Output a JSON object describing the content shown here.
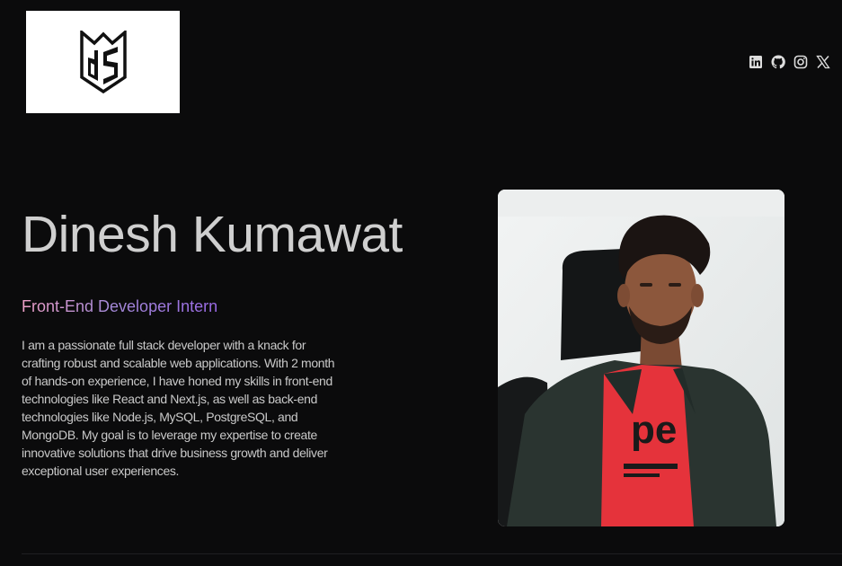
{
  "logo": {
    "icon": "ds-monogram-logo"
  },
  "social_links": [
    {
      "icon": "linkedin-icon"
    },
    {
      "icon": "github-icon"
    },
    {
      "icon": "instagram-icon"
    },
    {
      "icon": "x-icon"
    }
  ],
  "hero": {
    "name": "Dinesh Kumawat",
    "role": "Front-End Developer Intern",
    "bio": "I am a passionate full stack developer with a knack for crafting robust and scalable web applications. With 2 month of hands-on experience, I have honed my skills in front-end technologies like React and Next.js, as well as back-end technologies like Node.js, MySQL, PostgreSQL, and MongoDB. My goal is to leverage my expertise to create innovative solutions that drive business growth and deliver exceptional user experiences."
  },
  "colors": {
    "background": "#0b0b0c",
    "text": "#cfcfcf",
    "role_gradient_start": "#f0a0c8",
    "role_gradient_end": "#9a6ae6"
  }
}
